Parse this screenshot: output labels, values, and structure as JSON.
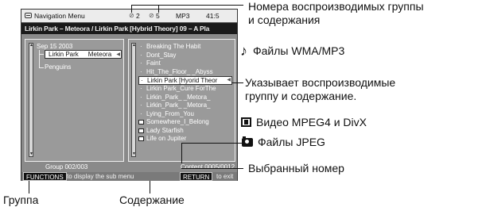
{
  "screen": {
    "menu_title": "Navigation Menu",
    "group_icon_a": "⊘",
    "group_num": "2",
    "group_icon_b": "⊘",
    "content_num": "5",
    "format": "MP3",
    "time": "41:5",
    "track_line": "Lirkin Park – Meteora / Lirkin Park [Hybrid Theory] 09 – A Pla",
    "group_tree": {
      "date": "Sep 15 2003",
      "selected_group_a": "Lirkin Park",
      "selected_group_b": "Meteora",
      "other_group": "Penguins"
    },
    "content_items": [
      {
        "label": "Breaking The Habit",
        "icon": "dot"
      },
      {
        "label": "Dont_Stay",
        "icon": "dot"
      },
      {
        "label": "Faint",
        "icon": "dot"
      },
      {
        "label": "Hit_The_Floor_ _Abyss",
        "icon": "dot"
      },
      {
        "label": "Lirkin Park [Hyorid Theor",
        "icon": "dot",
        "selected": true
      },
      {
        "label": "Lirkin Park_Cure ForThe",
        "icon": "dot"
      },
      {
        "label": "Lirkin_Park_ _Metora_",
        "icon": "dot"
      },
      {
        "label": "Lirkin_Park_ _Metora_",
        "icon": "dot"
      },
      {
        "label": "Lying_From_You",
        "icon": "dot"
      },
      {
        "label": "Somewhere_I_Belong",
        "icon": "video-icon"
      },
      {
        "label": "Lady Starfish",
        "icon": "photo-icon"
      },
      {
        "label": "Life on Jupiter",
        "icon": "photo-icon"
      }
    ],
    "group_counter": "Group 002/003",
    "content_counter": "Content 0005/0012",
    "functions_button": "FUNCTIONS",
    "functions_hint": "to display the sub menu",
    "return_button": "RETURN",
    "return_hint": "to exit",
    "play_mark": "◀"
  },
  "annotations": {
    "playing_numbers_line1": "Номера воспроизводимых группы",
    "playing_numbers_line2": "и содержания",
    "wma_mp3": "Файлы WMA/MP3",
    "indicates_line1": "Указывает воспроизводимые",
    "indicates_line2": "группу и содержание.",
    "video": "Видео MPEG4 и DivX",
    "jpeg": "Файлы JPEG",
    "selected_number": "Выбранный номер",
    "group": "Группа",
    "content": "Содержание"
  }
}
